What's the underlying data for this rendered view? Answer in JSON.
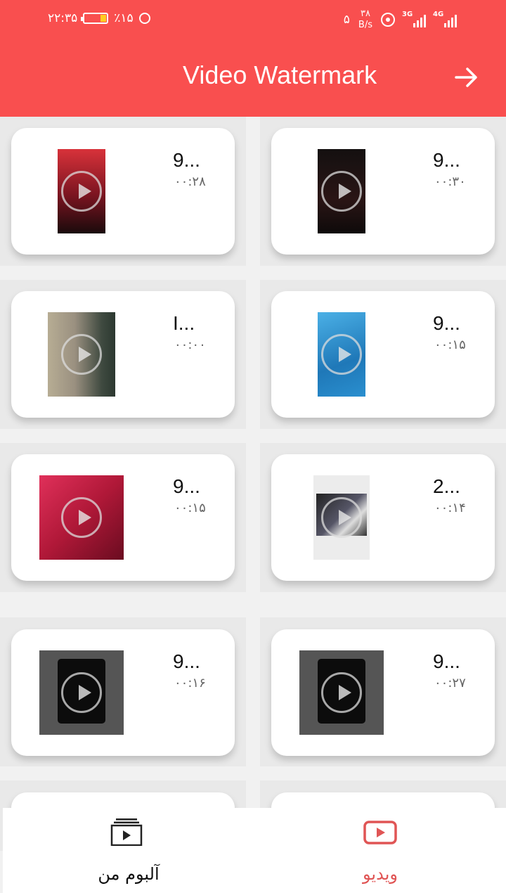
{
  "status_bar": {
    "time": "۲۲:۳۵",
    "battery": "٪۱۵",
    "notif_count": "۵",
    "net_speed_value": "۳۸",
    "net_speed_unit": "B/s",
    "signal1_label": "3G",
    "signal2_label": "4G"
  },
  "header": {
    "title": "Video Watermark",
    "next_icon": "arrow-right-icon"
  },
  "videos": [
    {
      "name": "9...",
      "duration": "۰۰:۳۰",
      "thumb_color": "#1a1212"
    },
    {
      "name": "9...",
      "duration": "۰۰:۲۸",
      "thumb_color": "#c0303a"
    },
    {
      "name": "9...",
      "duration": "۰۰:۱۵",
      "thumb_color": "#2a8fcf"
    },
    {
      "name": "I...",
      "duration": "۰۰:۰۰",
      "thumb_color": "#a9a391"
    },
    {
      "name": "2...",
      "duration": "۰۰:۱۴",
      "thumb_color": "#e8e8e8"
    },
    {
      "name": "9...",
      "duration": "۰۰:۱۵",
      "thumb_color": "#d0204a"
    },
    {
      "name": "9...",
      "duration": "۰۰:۲۷",
      "thumb_color": "#555555"
    },
    {
      "name": "9...",
      "duration": "۰۰:۱۶",
      "thumb_color": "#555555"
    }
  ],
  "bottom_nav": {
    "album": {
      "label": "آلبوم من",
      "icon": "album-icon"
    },
    "video": {
      "label": "ویدیو",
      "icon": "video-play-icon",
      "active": true
    }
  },
  "colors": {
    "accent": "#f94f4f",
    "nav_active": "#e05555"
  }
}
